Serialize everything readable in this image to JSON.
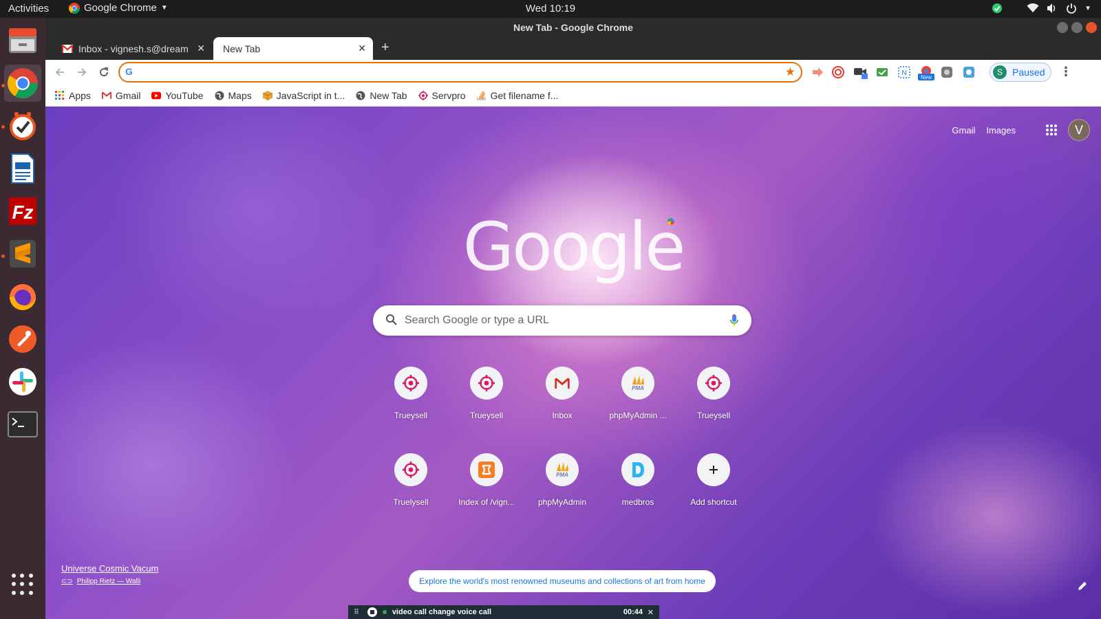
{
  "topbar": {
    "activities": "Activities",
    "app_name": "Google Chrome",
    "clock": "Wed 10:19"
  },
  "dock": {
    "apps": [
      "files-icon",
      "chrome-icon",
      "todo-icon",
      "writer-icon",
      "filezilla-icon",
      "sublime-icon",
      "firefox-icon",
      "postman-icon",
      "slack-icon",
      "terminal-icon"
    ]
  },
  "window": {
    "title": "New Tab - Google Chrome"
  },
  "tabs": [
    {
      "title": "Inbox - vignesh.s@dream",
      "active": false
    },
    {
      "title": "New Tab",
      "active": true
    }
  ],
  "omnibox": {
    "value": "",
    "placeholder": ""
  },
  "profile": {
    "initial": "S",
    "status": "Paused"
  },
  "bookmarks": [
    {
      "label": "Apps",
      "icon": "apps-grid-icon"
    },
    {
      "label": "Gmail",
      "icon": "gmail-icon"
    },
    {
      "label": "YouTube",
      "icon": "youtube-icon"
    },
    {
      "label": "Maps",
      "icon": "globe-icon"
    },
    {
      "label": "JavaScript in t...",
      "icon": "cube-icon"
    },
    {
      "label": "New Tab",
      "icon": "globe-icon"
    },
    {
      "label": "Servpro",
      "icon": "target-icon"
    },
    {
      "label": "Get filename f...",
      "icon": "stackoverflow-icon"
    }
  ],
  "ntp": {
    "header": {
      "gmail": "Gmail",
      "images": "Images",
      "avatar_initial": "V"
    },
    "logo": "Google",
    "search_placeholder": "Search Google or type a URL",
    "shortcuts": [
      {
        "label": "Trueysell",
        "icon": "target-icon"
      },
      {
        "label": "Trueysell",
        "icon": "target-icon"
      },
      {
        "label": "Inbox",
        "icon": "gmail-icon"
      },
      {
        "label": "phpMyAdmin ...",
        "icon": "pma-icon"
      },
      {
        "label": "Trueysell",
        "icon": "target-icon"
      },
      {
        "label": "Truelysell",
        "icon": "target-icon"
      },
      {
        "label": "Index of /vign...",
        "icon": "xampp-icon"
      },
      {
        "label": "phpMyAdmin",
        "icon": "pma-icon"
      },
      {
        "label": "medbros",
        "icon": "d-letter-icon"
      },
      {
        "label": "Add shortcut",
        "icon": "plus-icon"
      }
    ],
    "attribution_title": "Universe Cosmic Vacum",
    "attribution_author": "Philipp Rietz — Walli",
    "promo": "Explore the world's most renowned museums and collections of art from home"
  },
  "callbar": {
    "title": "video call change voice call",
    "time": "00:44"
  },
  "colors": {
    "accent_orange": "#e8710a",
    "ubuntu_orange": "#e95420",
    "link_blue": "#1a73e8"
  }
}
